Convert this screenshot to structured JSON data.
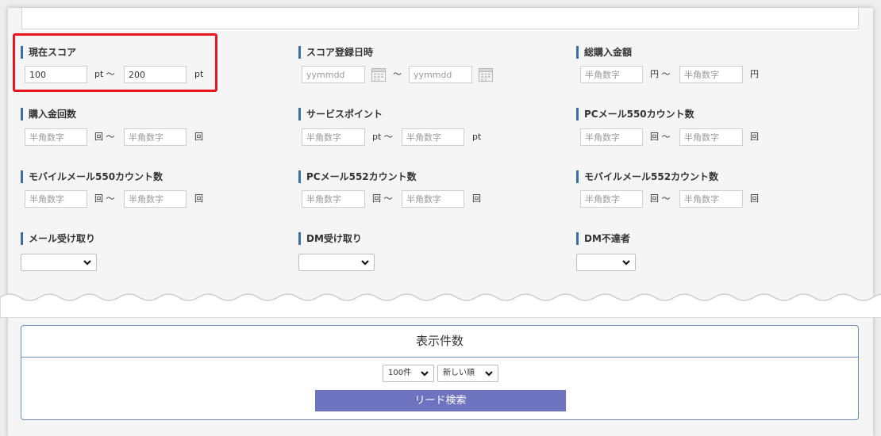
{
  "fields": {
    "current_score": {
      "label": "現在スコア",
      "from_value": "100",
      "to_value": "200",
      "unit": "pt",
      "sep": "pt ～"
    },
    "score_date": {
      "label": "スコア登録日時",
      "placeholder": "yymmdd",
      "sep": "～"
    },
    "total_purchase": {
      "label": "総購入金額",
      "placeholder": "半角数字",
      "unit": "円",
      "sep": "円 ～"
    },
    "purchase_count": {
      "label": "購入金回数",
      "placeholder": "半角数字",
      "unit": "回",
      "sep": "回 ～"
    },
    "service_point": {
      "label": "サービスポイント",
      "placeholder": "半角数字",
      "unit": "pt",
      "sep": "pt ～"
    },
    "pc_mail_550": {
      "label": "PCメール550カウント数",
      "placeholder": "半角数字",
      "unit": "回",
      "sep": "回 ～"
    },
    "mobile_mail_550": {
      "label": "モバイルメール550カウント数",
      "placeholder": "半角数字",
      "unit": "回",
      "sep": "回 ～"
    },
    "pc_mail_552": {
      "label": "PCメール552カウント数",
      "placeholder": "半角数字",
      "unit": "回",
      "sep": "回 ～"
    },
    "mobile_mail_552": {
      "label": "モバイルメール552カウント数",
      "placeholder": "半角数字",
      "unit": "回",
      "sep": "回 ～"
    },
    "mail_receive": {
      "label": "メール受け取り",
      "value": ""
    },
    "dm_receive": {
      "label": "DM受け取り",
      "value": ""
    },
    "dm_undelivered": {
      "label": "DM不達者",
      "value": ""
    }
  },
  "results": {
    "title": "表示件数",
    "count_value": "100件",
    "sort_value": "新しい順",
    "search_label": "リード検索"
  },
  "colors": {
    "accent": "#3a6fa5",
    "highlight": "#e6141e",
    "button": "#6d73bf"
  }
}
